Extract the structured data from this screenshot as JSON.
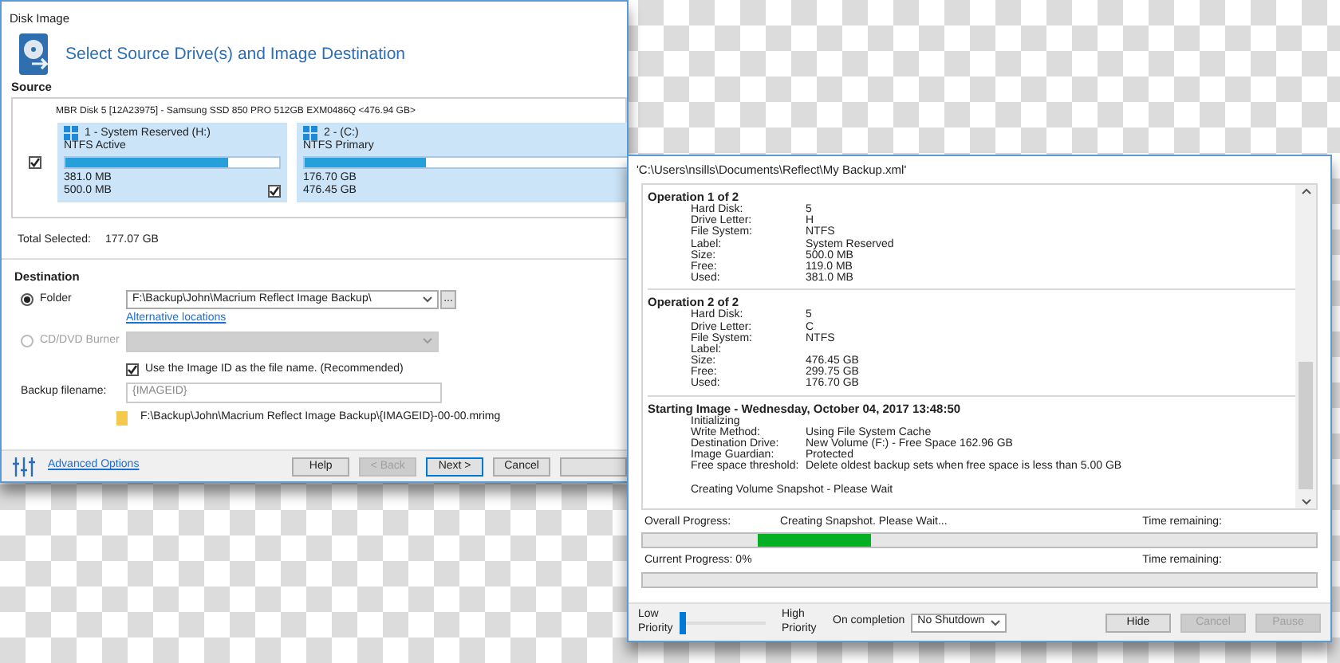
{
  "disk_image_window": {
    "title": "Disk Image",
    "heading": "Select Source Drive(s) and Image Destination",
    "source_label": "Source",
    "disk": {
      "label": "MBR Disk 5 [12A23975] - Samsung SSD 850 PRO 512GB EXM0486Q  <476.94 GB>",
      "checked": true
    },
    "partitions": [
      {
        "name": "1 - System Reserved (H:)",
        "fs": "NTFS Active",
        "used": "381.0 MB",
        "size": "500.0 MB",
        "level": 0.76,
        "checked": true
      },
      {
        "name": "2 - (C:)",
        "fs": "NTFS Primary",
        "used": "176.70 GB",
        "size": "476.45 GB",
        "level": 0.37
      }
    ],
    "total_selected_label": "Total Selected:",
    "total_selected_value": "177.07 GB",
    "destination_label": "Destination",
    "folder_option": {
      "label": "Folder",
      "selected": true,
      "path": "F:\\Backup\\John\\Macrium Reflect Image Backup\\",
      "browse": "...",
      "alt_link": "Alternative locations"
    },
    "cd_option": {
      "label": "CD/DVD Burner",
      "selected": false,
      "disabled": true
    },
    "use_image_id": {
      "label": "Use the Image ID as the file name.  (Recommended)",
      "checked": true
    },
    "backup_filename_label": "Backup filename:",
    "backup_filename_value": "{IMAGEID}",
    "path_preview": "F:\\Backup\\John\\Macrium Reflect Image Backup\\{IMAGEID}-00-00.mrimg",
    "advanced_link": "Advanced Options",
    "buttons": [
      {
        "label": "Help",
        "disabled": false,
        "focused": false
      },
      {
        "label": "< Back",
        "disabled": true,
        "focused": false
      },
      {
        "label": "Next >",
        "disabled": false,
        "focused": true
      },
      {
        "label": "Cancel",
        "disabled": false,
        "focused": false
      }
    ]
  },
  "progress_window": {
    "title": "'C:\\Users\\nsills\\Documents\\Reflect\\My Backup.xml'",
    "sections": [
      {
        "heading": "Operation 1 of 2",
        "rows": [
          {
            "kind": "pair",
            "label": "Hard Disk:",
            "value": "5"
          },
          {
            "kind": "pair",
            "label": "Drive Letter:",
            "value": "H"
          },
          {
            "kind": "pair",
            "label": "File System:",
            "value": "NTFS"
          },
          {
            "kind": "pair",
            "label": "Label:",
            "value": "System Reserved"
          },
          {
            "kind": "pair",
            "label": "Size:",
            "value": "500.0 MB"
          },
          {
            "kind": "pair",
            "label": "Free:",
            "value": "119.0 MB"
          },
          {
            "kind": "pair",
            "label": "Used:",
            "value": "381.0 MB"
          }
        ]
      },
      {
        "heading": "Operation 2 of 2",
        "rows": [
          {
            "kind": "pair",
            "label": "Hard Disk:",
            "value": "5"
          },
          {
            "kind": "pair",
            "label": "Drive Letter:",
            "value": "C"
          },
          {
            "kind": "pair",
            "label": "File System:",
            "value": "NTFS"
          },
          {
            "kind": "pair",
            "label": "Label:"
          },
          {
            "kind": "pair",
            "label": "Size:",
            "value": "476.45 GB"
          },
          {
            "kind": "pair",
            "label": "Free:",
            "value": "299.75 GB"
          },
          {
            "kind": "pair",
            "label": "Used:",
            "value": "176.70 GB"
          }
        ]
      },
      {
        "heading": "Starting Image - Wednesday, October 04, 2017 13:48:50",
        "rows": [
          {
            "kind": "note",
            "text": "Initializing"
          },
          {
            "kind": "pair",
            "label": "Write Method:",
            "value": "Using File System Cache"
          },
          {
            "kind": "pair",
            "label": "Destination Drive:",
            "value": "New Volume (F:) - Free Space 162.96 GB"
          },
          {
            "kind": "pair",
            "label": "Image Guardian:",
            "value": "Protected"
          },
          {
            "kind": "pair",
            "label": "Free space threshold:",
            "value": "Delete oldest backup sets when free space is less than 5.00 GB"
          },
          {
            "kind": "gap"
          },
          {
            "kind": "note",
            "text": "Creating Volume Snapshot - Please Wait"
          }
        ]
      }
    ],
    "overall": {
      "label": "Overall Progress:",
      "status": "Creating Snapshot. Please Wait...",
      "time_label": "Time remaining:",
      "level": 0.17
    },
    "current": {
      "label": "Current Progress:  0%",
      "time_label": "Time remaining:",
      "level": 0
    },
    "priority": {
      "low_label": "Low Priority",
      "high_label": "High Priority",
      "level": 0
    },
    "on_completion_label": "On completion",
    "on_completion_value": "No Shutdown",
    "buttons": [
      {
        "label": "Hide",
        "disabled": false
      },
      {
        "label": "Cancel",
        "disabled": true
      },
      {
        "label": "Pause",
        "disabled": true
      }
    ]
  }
}
